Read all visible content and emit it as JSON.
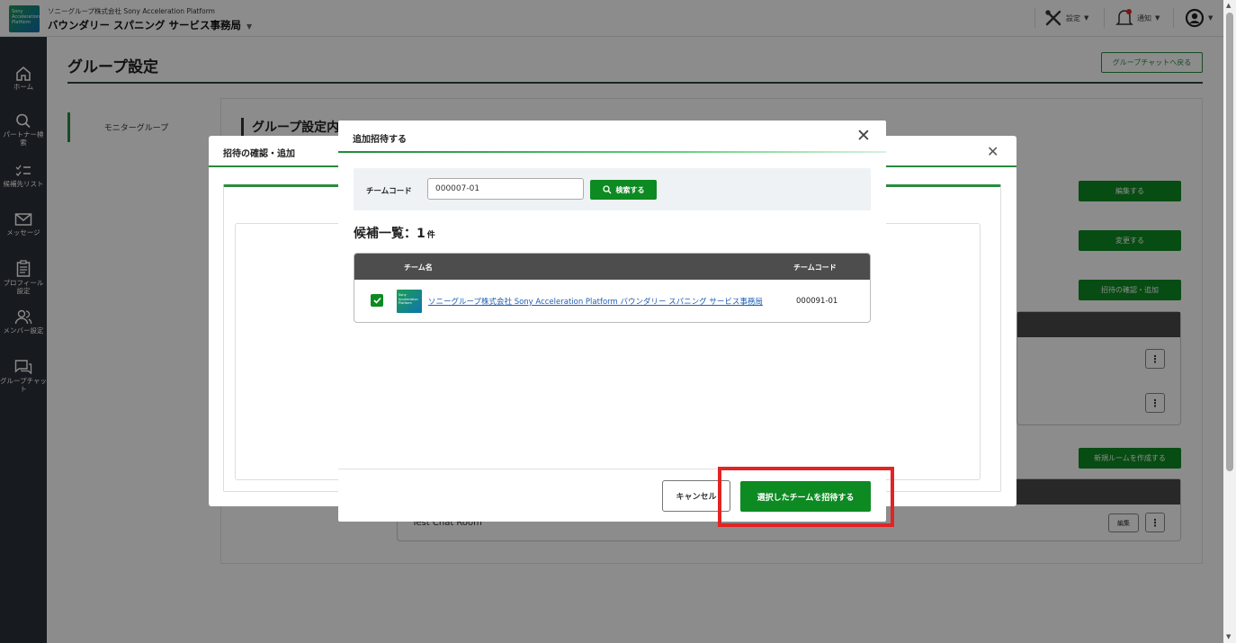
{
  "header": {
    "logo_text": "Sony Acceleration Platform",
    "org_small": "ソニーグループ株式会社 Sony Acceleration Platform",
    "org_name": "バウンダリー スパニング サービス事務局",
    "settings_label": "設定",
    "notifications_label": "通知"
  },
  "sidebar": {
    "items": [
      {
        "label": "ホーム"
      },
      {
        "label": "パートナー検索"
      },
      {
        "label": "候補先リスト"
      },
      {
        "label": "メッセージ"
      },
      {
        "label": "プロフィール設定"
      },
      {
        "label": "メンバー設定"
      },
      {
        "label": "グループチャット"
      }
    ]
  },
  "page": {
    "title": "グループ設定",
    "back_button": "グループチャットへ戻る",
    "left_tab": "モニターグループ",
    "section_title": "グループ設定内",
    "edit_button": "編集する",
    "change_button": "変更する",
    "confirm_add_button": "招待の確認・追加",
    "new_room_button": "新規ルームを作成する",
    "room_name": "Test Chat Room",
    "room_edit": "編集"
  },
  "back_modal": {
    "title": "招待の確認・追加"
  },
  "modal": {
    "title": "追加招待する",
    "search_label": "チームコード",
    "search_value": "000007-01",
    "search_button": "検索する",
    "count_label": "候補一覧：",
    "count_value": "1",
    "count_unit": "件",
    "table": {
      "col_name": "チーム名",
      "col_code": "チームコード",
      "rows": [
        {
          "name": "ソニーグループ株式会社 Sony Acceleration Platform バウンダリー スパニング サービス事務局",
          "code": "000091-01",
          "checked": true,
          "logo_text": "Sony Acceleration Platform"
        }
      ]
    },
    "cancel_button": "キャンセル",
    "invite_button": "選択したチームを招待する"
  },
  "colors": {
    "accent_green": "#0d8a22",
    "sidebar_bg": "#2b3038",
    "highlight_red": "#e12424",
    "link_blue": "#1d5fb4"
  }
}
